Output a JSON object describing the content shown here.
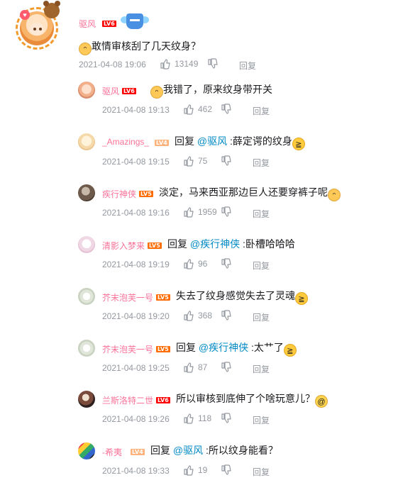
{
  "main": {
    "username": "驱风",
    "level": "LV6",
    "content": "敢情审核刮了几天纹身？",
    "time": "2021-04-08 19:06",
    "likes": "13149",
    "reply_label": "回复"
  },
  "replies": [
    {
      "username": "驱风",
      "level": "LV6",
      "lead_emoji": "cat-emoji",
      "text": "我错了，原来纹身带开关",
      "time": "2021-04-08 19:13",
      "likes": "462",
      "reply_label": "回复"
    },
    {
      "username": "_Amazings_",
      "level": "LV4",
      "prefix": "回复 ",
      "mention": "@驱风",
      "text": " :薛定谔的纹身",
      "trail_emoji": "laugh-emoji",
      "time": "2021-04-08 19:15",
      "likes": "75",
      "reply_label": "回复"
    },
    {
      "username": "疾行神侠",
      "level": "LV5",
      "text": "淡定，马来西亚那边巨人还要穿裤子呢",
      "trail_emoji": "cat-emoji",
      "time": "2021-04-08 19:16",
      "likes": "1959",
      "reply_label": "回复"
    },
    {
      "username": "清影入梦来",
      "level": "LV5",
      "prefix": "回复 ",
      "mention": "@疾行神侠",
      "text": " :卧槽哈哈哈",
      "time": "2021-04-08 19:19",
      "likes": "96",
      "reply_label": "回复"
    },
    {
      "username": "芥末泡芙一号",
      "level": "LV5",
      "text": "失去了纹身感觉失去了灵魂",
      "trail_emoji": "laugh-emoji",
      "time": "2021-04-08 19:20",
      "likes": "368",
      "reply_label": "回复"
    },
    {
      "username": "芥末泡芙一号",
      "level": "LV5",
      "prefix": "回复 ",
      "mention": "@疾行神侠",
      "text": " :太艹了",
      "trail_emoji": "laugh-emoji",
      "time": "2021-04-08 19:25",
      "likes": "87",
      "reply_label": "回复"
    },
    {
      "username": "兰斯洛特二世",
      "level": "LV6",
      "text": "所以审核到底伸了个啥玩意儿？",
      "trail_emoji": "dizzy-emoji",
      "time": "2021-04-08 19:26",
      "likes": "118",
      "reply_label": "回复"
    },
    {
      "username": "-希夷",
      "level": "LV4",
      "prefix": "回复 ",
      "mention": "@驱风",
      "text": " :所以纹身能看？",
      "time": "2021-04-08 19:33",
      "likes": "19",
      "reply_label": "回复"
    }
  ],
  "colors": {
    "accent_pink": "#fb7299",
    "mention_blue": "#008ac5",
    "meta_gray": "#9499a0",
    "lv6": "#ff0000",
    "lv5": "#ff6c00",
    "lv4": "#ffb37c"
  }
}
